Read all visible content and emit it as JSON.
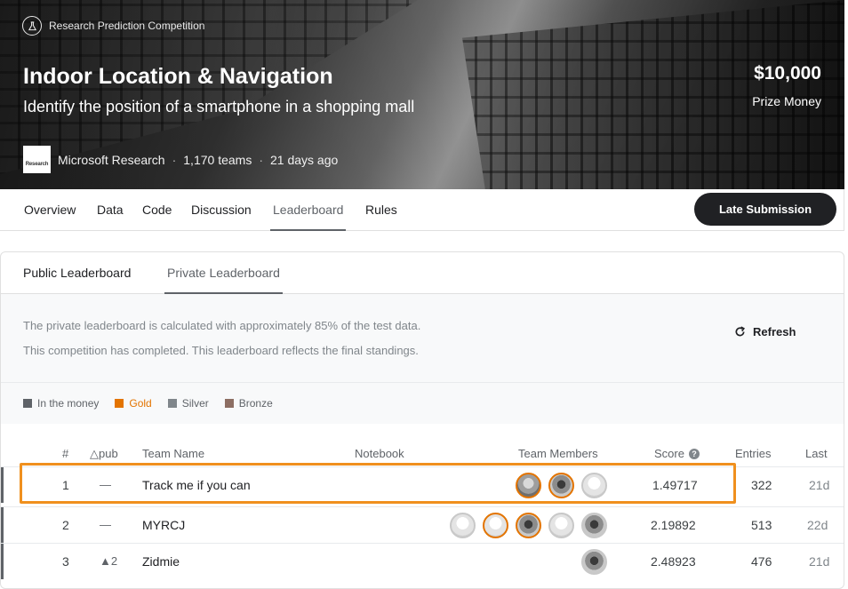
{
  "banner": {
    "competition_type": "Research Prediction Competition",
    "title": "Indoor Location & Navigation",
    "subtitle": "Identify the position of a smartphone in a shopping mall",
    "prize_amount": "$10,000",
    "prize_label": "Prize Money",
    "host_logo_text": "Research",
    "host": "Microsoft Research",
    "teams": "1,170 teams",
    "age": "21 days ago",
    "separator": "·"
  },
  "nav": {
    "tabs": [
      "Overview",
      "Data",
      "Code",
      "Discussion",
      "Leaderboard",
      "Rules"
    ],
    "active_tab": "Leaderboard",
    "late_submission_label": "Late Submission"
  },
  "leaderboard": {
    "tabs": [
      "Public Leaderboard",
      "Private Leaderboard"
    ],
    "active_tab": "Private Leaderboard",
    "info_line_1": "The private leaderboard is calculated with approximately 85% of the test data.",
    "info_line_2": "This competition has completed. This leaderboard reflects the final standings.",
    "refresh_label": "Refresh",
    "legend": [
      {
        "label": "In the money",
        "color": "#5f6368"
      },
      {
        "label": "Gold",
        "color": "#e37400"
      },
      {
        "label": "Silver",
        "color": "#80868b"
      },
      {
        "label": "Bronze",
        "color": "#8d6e63"
      }
    ],
    "columns": {
      "rank": "#",
      "delta": "△pub",
      "team": "Team Name",
      "notebook": "Notebook",
      "members": "Team Members",
      "score": "Score",
      "entries": "Entries",
      "last": "Last"
    },
    "rows": [
      {
        "rank": "1",
        "delta": "—",
        "team": "Track me if you can",
        "score": "1.49717",
        "entries": "322",
        "last": "21d"
      },
      {
        "rank": "2",
        "delta": "—",
        "team": "MYRCJ",
        "score": "2.19892",
        "entries": "513",
        "last": "22d"
      },
      {
        "rank": "3",
        "delta": "▲2",
        "team": "Zidmie",
        "score": "2.48923",
        "entries": "476",
        "last": "21d"
      }
    ]
  },
  "colors": {
    "highlight": "#f0901e",
    "gold": "#e37400",
    "dark_button": "#202124"
  }
}
